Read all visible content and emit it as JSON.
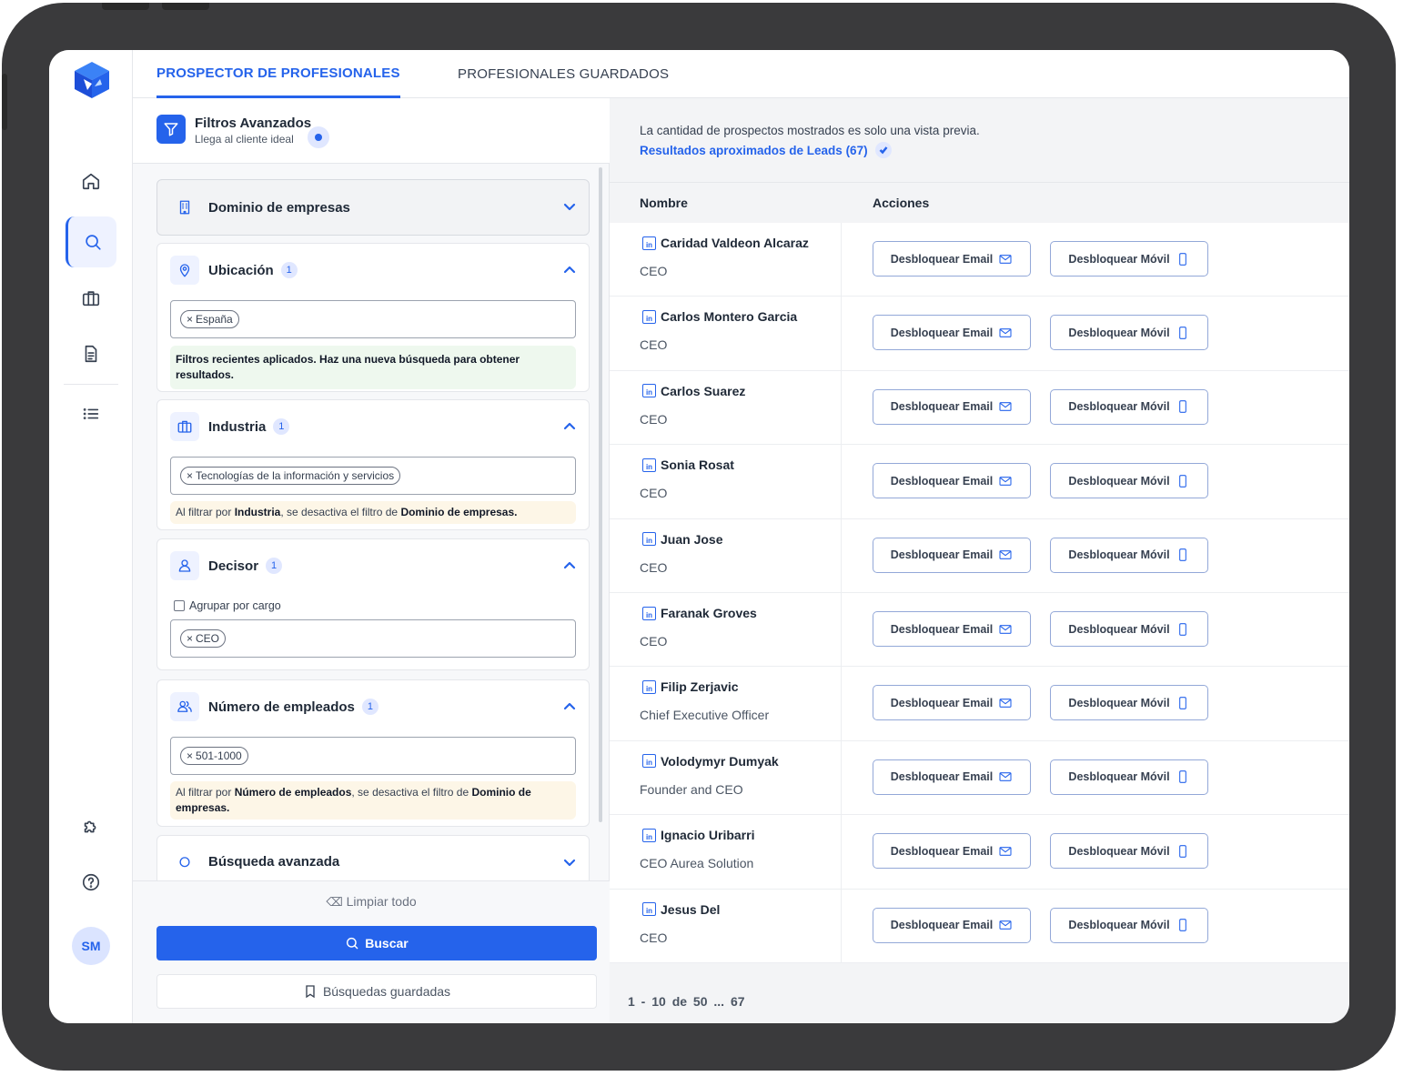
{
  "tabs": {
    "active": "PROSPECTOR DE PROFESIONALES",
    "saved": "PROFESIONALES GUARDADOS"
  },
  "filters": {
    "title": "Filtros Avanzados",
    "subtitle": "Llega al cliente ideal",
    "domain": {
      "title": "Dominio de empresas"
    },
    "location": {
      "title": "Ubicación",
      "count": "1",
      "tag": "España",
      "note": "Filtros recientes aplicados. Haz una nueva búsqueda para obtener resultados."
    },
    "industry": {
      "title": "Industria",
      "count": "1",
      "tag": "Tecnologías de la información y servicios",
      "note_pre": "Al filtrar por ",
      "note_b1": "Industria",
      "note_mid": ", se desactiva el filtro de ",
      "note_b2": "Dominio de empresas."
    },
    "decisor": {
      "title": "Decisor",
      "count": "1",
      "checkbox": "Agrupar por cargo",
      "tag": "CEO"
    },
    "employees": {
      "title": "Número de empleados",
      "count": "1",
      "tag": "501-1000",
      "note_pre": "Al filtrar por ",
      "note_b1": "Número de empleados",
      "note_mid": ", se desactiva el filtro de ",
      "note_b2": "Dominio de empresas."
    },
    "advanced": {
      "title": "Búsqueda avanzada"
    },
    "clear": "Limpiar todo",
    "search": "Buscar",
    "saved": "Búsquedas guardadas"
  },
  "results": {
    "info": "La cantidad de prospectos mostrados es solo una vista previa.",
    "count": "Resultados aproximados de Leads (67)",
    "col_name": "Nombre",
    "col_actions": "Acciones",
    "email_btn": "Desbloquear Email",
    "phone_btn": "Desbloquear Móvil",
    "rows": [
      {
        "name": "Caridad Valdeon Alcaraz",
        "role": "CEO"
      },
      {
        "name": "Carlos Montero Garcia",
        "role": "CEO"
      },
      {
        "name": "Carlos Suarez",
        "role": "CEO"
      },
      {
        "name": "Sonia Rosat",
        "role": "CEO"
      },
      {
        "name": "Juan Jose",
        "role": "CEO"
      },
      {
        "name": "Faranak Groves",
        "role": "CEO"
      },
      {
        "name": "Filip Zerjavic",
        "role": "Chief Executive Officer"
      },
      {
        "name": "Volodymyr Dumyak",
        "role": "Founder and CEO"
      },
      {
        "name": "Ignacio Uribarri",
        "role": "CEO Aurea Solution"
      },
      {
        "name": "Jesus Del",
        "role": "CEO"
      }
    ],
    "pager": "1 - 10  de  50 ... 67"
  },
  "user": {
    "initials": "SM"
  },
  "colors": {
    "accent": "#2563eb",
    "frame": "#3a3a3c"
  }
}
